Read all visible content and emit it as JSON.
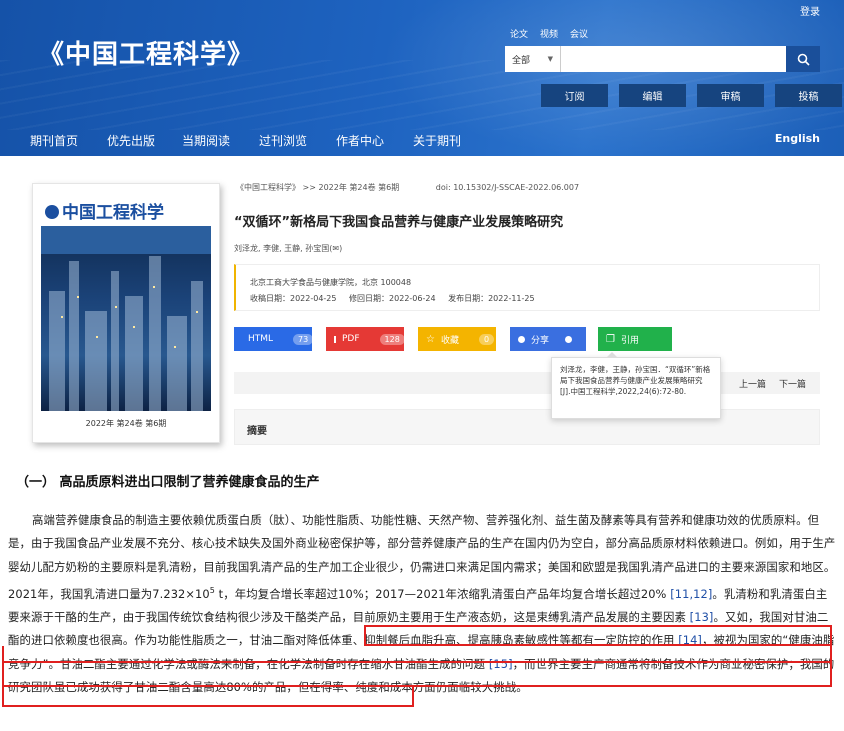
{
  "header": {
    "login": "登录",
    "logo": "《中国工程科学》",
    "top_links": [
      "论文",
      "视频",
      "会议"
    ],
    "search_scope": "全部",
    "search_placeholder": "",
    "actions": [
      "订阅",
      "编辑",
      "审稿",
      "投稿"
    ]
  },
  "nav": {
    "items": [
      "期刊首页",
      "优先出版",
      "当期阅读",
      "过刊浏览",
      "作者中心",
      "关于期刊"
    ],
    "english": "English"
  },
  "cover": {
    "title": "中国工程科学",
    "issue": "2022年 第24卷 第6期"
  },
  "article": {
    "breadcrumb": "《中国工程科学》 >> 2022年 第24卷 第6期",
    "doi": "doi: 10.15302/J-SSCAE-2022.06.007",
    "title": "“双循环”新格局下我国食品营养与健康产业发展策略研究",
    "authors": "刘泽龙, 李健, 王静, 孙宝国(✉)",
    "affiliation": "北京工商大学食品与健康学院，北京 100048",
    "received": "收稿日期：2022-04-25",
    "revised": "修回日期：2022-06-24",
    "published": "发布日期：2022-11-25"
  },
  "tools": {
    "html_label": "HTML",
    "html_count": "73",
    "pdf_label": "PDF",
    "pdf_count": "128",
    "fav_label": "收藏",
    "fav_count": "0",
    "share_label": "分享",
    "cite_label": "引用"
  },
  "pager": {
    "prev": "上一篇",
    "next": "下一篇"
  },
  "citation_popup": "刘泽龙，李健，王静，孙宝国．“双循环”新格局下我国食品营养与健康产业发展策略研究[J].中国工程科学,2022,24(6):72-80.",
  "abstract_label": "摘要",
  "section_heading": "（一）  高品质原料进出口限制了营养健康食品的生产",
  "paragraph": {
    "p1": "高端营养健康食品的制造主要依赖优质蛋白质（肽）、功能性脂质、功能性糖、天然产物、营养强化剂、益生菌及酵素等具有营养和健康功效的优质原料。但是，由于我国食品产业发展不充分、核心技术缺失及国外商业秘密保护等，部分营养健康产品的生产在国内仍为空白，部分高品质原材料依赖进口。例如，用于生产婴幼儿配方奶粉的主要原料是乳清粉，目前我国乳清产品的生产加工企业很少，仍需进口来满足国内需求；美国和欧盟是我国乳清产品进口的主要来源国家和地区。2021年，我国乳清进口量为7.232×10",
    "sup": "5",
    "p2": " t，年均复合增长率超过10%；2017—2021年浓缩乳清蛋白产品年均复合增长超过20% ",
    "ref1": "[11,12]",
    "p3": "。乳清粉和乳清蛋白主要来源于干酪的生产，由于我国传统饮食结构很少涉及干酪类产品，目前原奶主要用于生产液态奶，这是束缚乳清产品发展的主要因素 ",
    "ref2": "[13]",
    "p4": "。又如，我国对甘油二酯的进口依赖度也很高。作为功能性脂质之一，甘油二酯对降低体重、抑制餐后血脂升高、提高胰岛素敏感性等都有一定防控的作用 ",
    "ref3": "[14]",
    "p5": "，被视为国家的“健康油脂竞争力”。甘油二酯主要通过化学法或酶法来制备，在化学法制备时存在缩水甘油酯生成的问题 ",
    "ref4": "[15]",
    "p6": "，而世界主要生产商通常将制备技术作为商业秘密保护；我国的研究团队虽已成功获得了甘油二酯含量高达80%的产品，但在得率、纯度和成本方面仍面临较大挑战。"
  },
  "colors": {
    "header_blue": "#1e63c0",
    "highlight_red": "#e0201f",
    "html_blue": "#2a6ae6",
    "pdf_red": "#e53935",
    "fav_yellow": "#f4b400",
    "cite_green": "#21b14b"
  }
}
